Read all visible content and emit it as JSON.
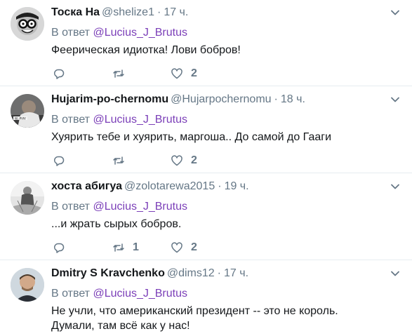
{
  "tweets": [
    {
      "name": "Тоска На",
      "handle": "@shelize1",
      "time": "17 ч.",
      "reply_prefix": "В ответ",
      "reply_to": "@Lucius_J_Brutus",
      "text": "Феерическая идиотка! Лови бобров!",
      "retweets": "",
      "likes": "2"
    },
    {
      "name": "Hujarim-po-chernomu",
      "handle": "@Hujarpochernomu",
      "time": "18 ч.",
      "reply_prefix": "В ответ",
      "reply_to": "@Lucius_J_Brutus",
      "text": "Хуярить тебе и хуярить, маргоша.. До самой до Гааги",
      "retweets": "",
      "likes": "2"
    },
    {
      "name": "хоста абигуа",
      "handle": "@zolotarewa2015",
      "time": "19 ч.",
      "reply_prefix": "В ответ",
      "reply_to": "@Lucius_J_Brutus",
      "text": "...и жрать сырых бобров.",
      "retweets": "1",
      "likes": "2"
    },
    {
      "name": "Dmitry S Kravchenko",
      "handle": "@dims12",
      "time": "17 ч.",
      "reply_prefix": "В ответ",
      "reply_to": "@Lucius_J_Brutus",
      "text_line1": "Не учли, что американский президент -- это не король.",
      "text_line2": "Думали, там всё как у нас!"
    }
  ],
  "icons": {
    "reply": "reply-icon",
    "retweet": "retweet-icon",
    "like": "heart-icon",
    "more": "chevron-down-icon"
  },
  "colors": {
    "mention": "#7b3fb8",
    "secondary_text": "#657786",
    "divider": "#e6ecf0"
  }
}
